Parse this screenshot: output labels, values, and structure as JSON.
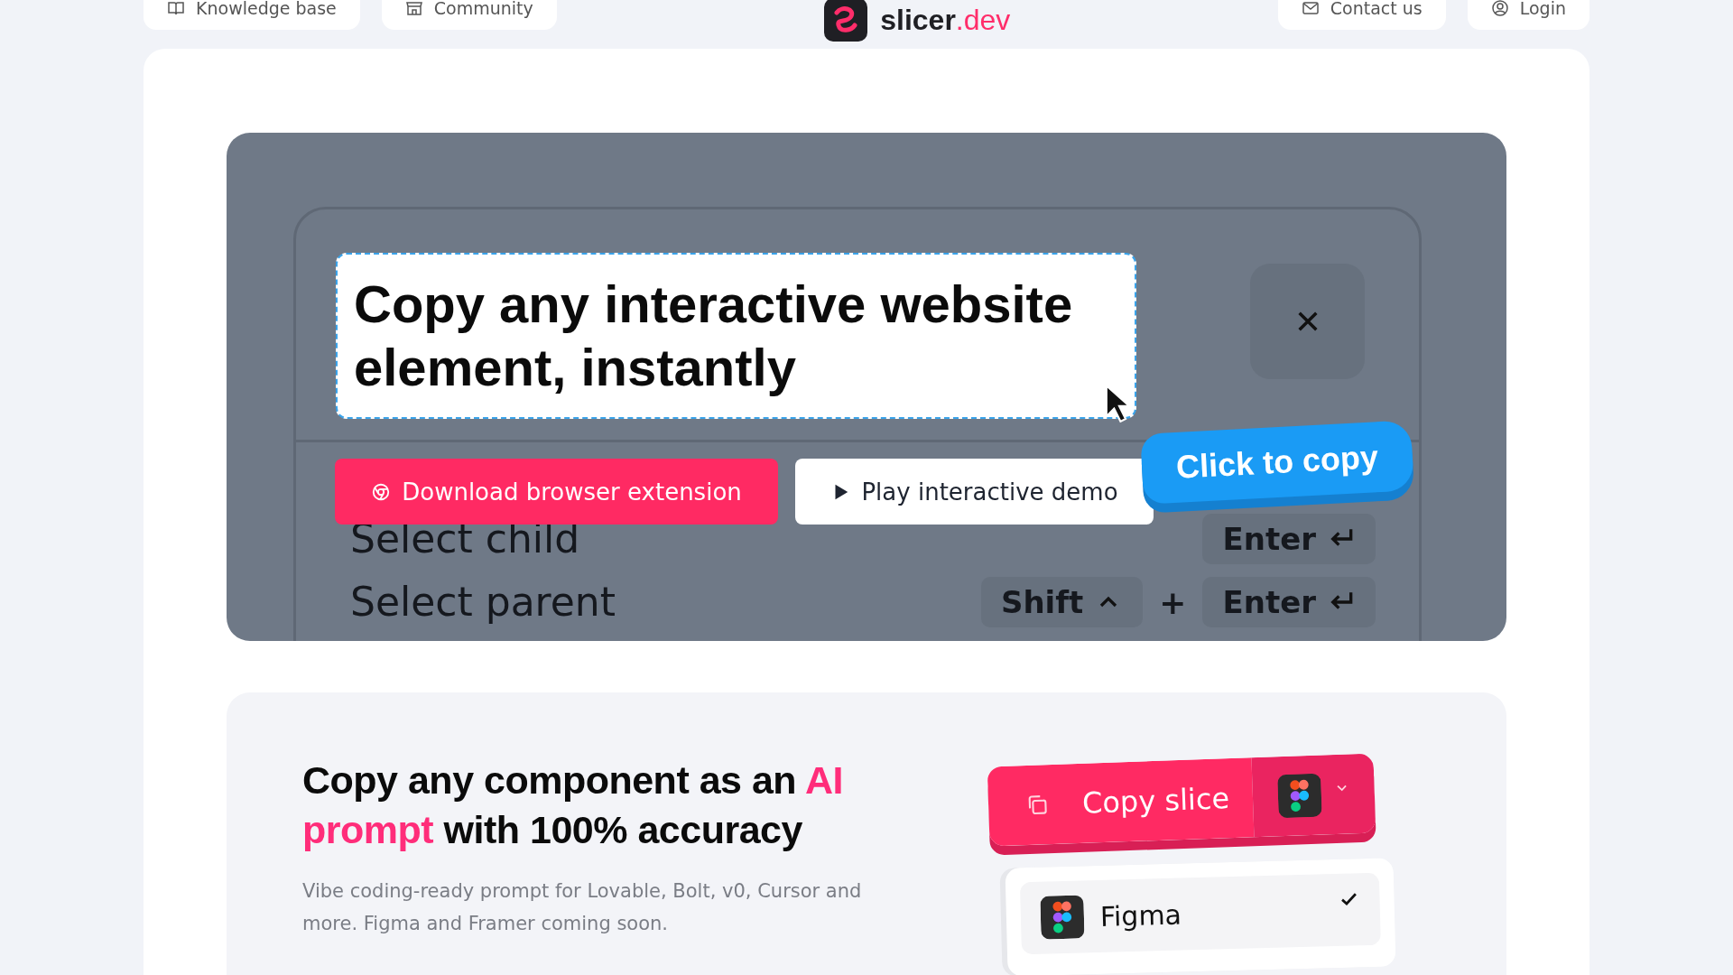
{
  "nav": {
    "left": [
      {
        "label": "Knowledge base",
        "kind": "book"
      },
      {
        "label": "Community",
        "kind": "store"
      }
    ],
    "logo": {
      "name": "slicer",
      "suffix": ".dev"
    },
    "right": [
      {
        "label": "Contact us",
        "kind": "mail"
      },
      {
        "label": "Login",
        "kind": "user"
      }
    ]
  },
  "hero": {
    "headline": "Copy any interactive website element, instantly",
    "buttons": [
      {
        "label": "Download browser extension",
        "kind": "primary"
      },
      {
        "label": "Play interactive demo",
        "kind": "secondary"
      }
    ],
    "copy_tooltip": "Click to copy",
    "shortcuts": [
      {
        "label": "Select child",
        "keys": [
          {
            "label": "Enter",
            "kind": "enter"
          }
        ]
      },
      {
        "label": "Select parent",
        "keys": [
          {
            "label": "Shift",
            "kind": "shift"
          },
          {
            "label": "Enter",
            "kind": "enter"
          }
        ],
        "joiner": "+"
      }
    ]
  },
  "feature": {
    "title": "Copy any component as an **AI prompt** with 100% accuracy",
    "description": "Vibe coding-ready prompt for Lovable, Bolt, v0, Cursor and more. Figma and Framer coming soon.",
    "copy_button": "Copy slice",
    "targets": [
      {
        "label": "Figma",
        "selected": true
      }
    ]
  }
}
